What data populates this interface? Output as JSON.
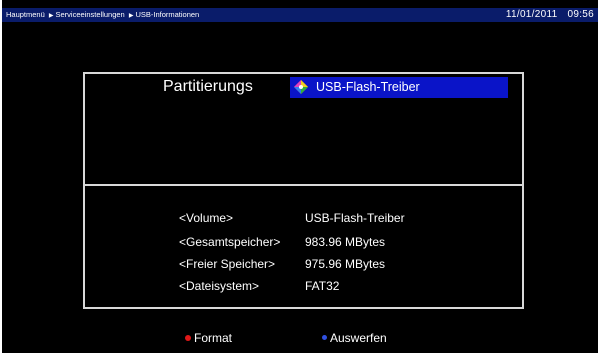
{
  "header": {
    "breadcrumb": [
      "Hauptmenü",
      "Serviceeinstellungen",
      "USB-Informationen"
    ],
    "date": "11/01/2011",
    "time": "09:56"
  },
  "partition": {
    "label": "Partitierungs",
    "selected": "USB-Flash-Treiber"
  },
  "info": [
    {
      "key": "<Volume>",
      "value": "USB-Flash-Treiber"
    },
    {
      "key": "<Gesamtspeicher>",
      "value": "983.96 MBytes"
    },
    {
      "key": "<Freier Speicher>",
      "value": "975.96 MBytes"
    },
    {
      "key": "<Dateisystem>",
      "value": "FAT32"
    }
  ],
  "footer": {
    "red_label": "Format",
    "blue_label": "Auswerfen"
  },
  "colors": {
    "background": "#000000",
    "topbar": "#0a1c6a",
    "selection": "#0a14c8",
    "border": "#d8d8d8",
    "red_key": "#e01818",
    "blue_key": "#3050e0"
  },
  "icons": {
    "breadcrumb_separator": "triangle-right-icon",
    "partition_icon": "usb-drive-icon",
    "red_button": "red-dot-icon",
    "blue_button": "blue-dot-icon"
  }
}
